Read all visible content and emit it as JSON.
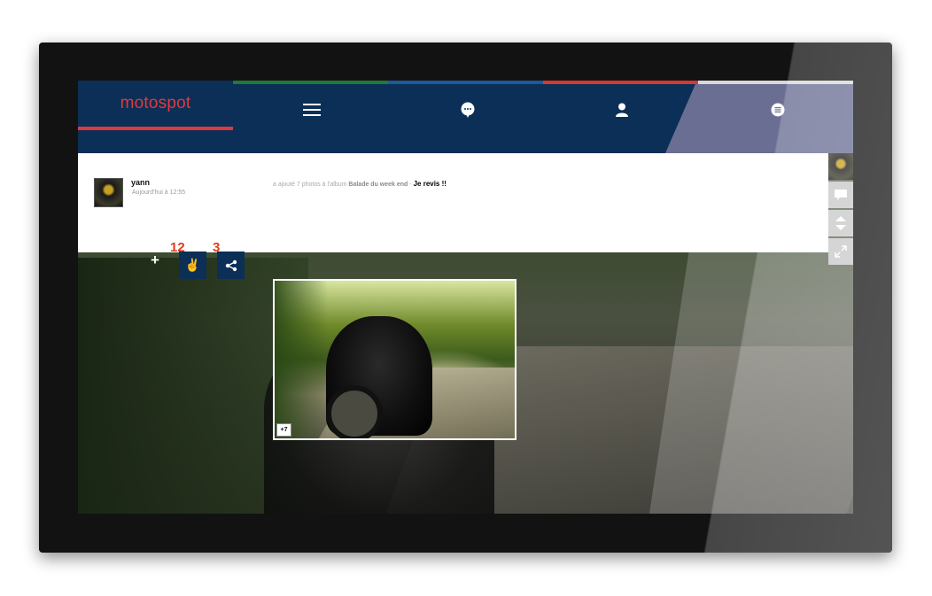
{
  "app": {
    "brand": "motospot"
  },
  "nav": {
    "items": [
      {
        "icon": "menu-icon"
      },
      {
        "icon": "chat-icon"
      },
      {
        "icon": "user-icon"
      },
      {
        "icon": "list-icon"
      }
    ],
    "stripe_colors": [
      "#1f7a3a",
      "#1e5a9a",
      "#d43a35",
      "#d8d8d8"
    ],
    "accent": "#e0393e",
    "bar_color": "#0b2f56"
  },
  "post": {
    "user": "yann",
    "time": "Aujourd'hui à 12:55",
    "action_prefix": "a ajouté 7 photos à l'album",
    "album": "Balade du week end",
    "separator": "-",
    "comment": "Je revis !!",
    "photo_more": "+7"
  },
  "reactions": {
    "add_label": "+",
    "victory_count": "12",
    "share_count": "3",
    "victory_icon": "victory-hand-icon",
    "share_icon": "share-icon"
  },
  "sidebar": {
    "tools": [
      {
        "icon": "comment-icon"
      },
      {
        "icon": "collapse-icon"
      },
      {
        "icon": "expand-icon"
      }
    ]
  }
}
